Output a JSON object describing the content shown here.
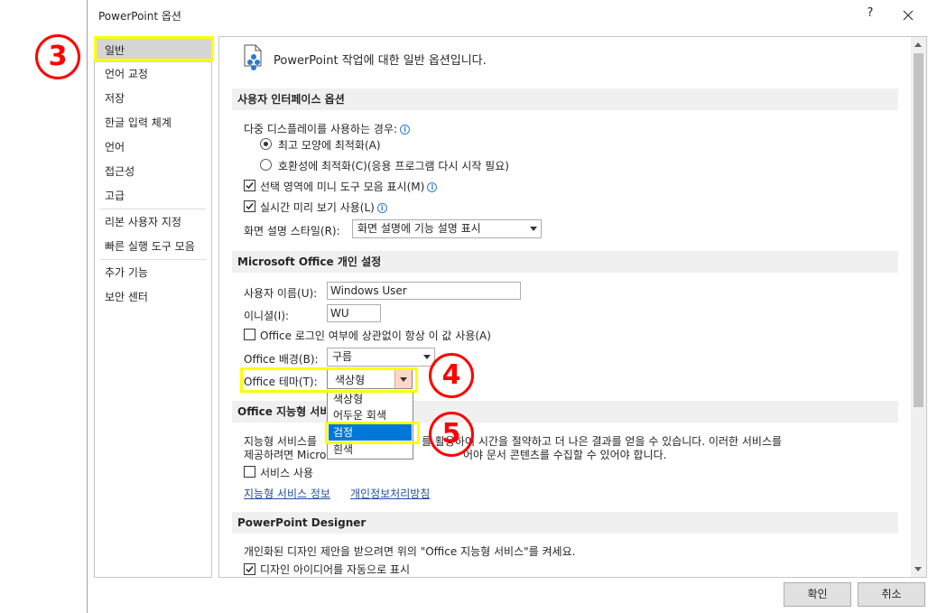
{
  "window": {
    "title": "PowerPoint 옵션",
    "help": "?"
  },
  "nav": {
    "items": [
      {
        "label": "일반"
      },
      {
        "label": "언어 교정"
      },
      {
        "label": "저장"
      },
      {
        "label": "한글 입력 체계"
      },
      {
        "label": "언어"
      },
      {
        "label": "접근성"
      },
      {
        "label": "고급"
      },
      {
        "label": "리본 사용자 지정"
      },
      {
        "label": "빠른 실행 도구 모음"
      },
      {
        "label": "추가 기능"
      },
      {
        "label": "보안 센터"
      }
    ],
    "selected": "일반"
  },
  "header": {
    "text": "PowerPoint 작업에 대한 일반 옵션입니다."
  },
  "ui_options": {
    "title": "사용자 인터페이스 옵션",
    "multi_display_label": "다중 디스플레이를 사용하는 경우:",
    "radio_optimize_appearance": "최고 모양에 최적화(A)",
    "radio_optimize_compat": "호환성에 최적화(C)(응용 프로그램 다시 시작 필요)",
    "mini_toolbar": "선택 영역에 미니 도구 모음 표시(M)",
    "live_preview": "실시간 미리 보기 사용(L)",
    "screentip_label": "화면 설명 스타일(R):",
    "screentip_value": "화면 설명에 기능 설명 표시"
  },
  "personalize": {
    "title": "Microsoft Office 개인 설정",
    "username_label": "사용자 이름(U):",
    "username_value": "Windows User",
    "initials_label": "이니셜(I):",
    "initials_value": "WU",
    "always_use_label": "Office 로그인 여부에 상관없이 항상 이 값 사용(A)",
    "background_label": "Office 배경(B):",
    "background_value": "구름",
    "theme_label": "Office 테마(T):",
    "theme_value": "색상형",
    "theme_options": [
      "색상형",
      "어두운 회색",
      "검정",
      "흰색"
    ],
    "theme_highlighted": "검정"
  },
  "intelligent": {
    "title": "Office 지능형 서비",
    "desc_line1_a": "지능형 서비스를",
    "desc_line1_b": "를 활용하여 시간을 절약하고 더 나은 결과를 얻을 수 있습니다. 이러한 서비스를",
    "desc_line2_a": "제공하려면 Micro",
    "desc_line2_b": "어야 문서 콘텐츠를 수집할 수 있어야 합니다.",
    "enable_label": "서비스 사용",
    "link_about": "지능형 서비스 정보",
    "link_privacy": "개인정보처리방침"
  },
  "designer": {
    "title": "PowerPoint Designer",
    "desc": "개인화된 디자인 제안을 받으려면 위의 \"Office 지능형 서비스\"를 켜세요.",
    "auto_show": "디자인 아이디어를 자동으로 표시"
  },
  "buttons": {
    "ok": "확인",
    "cancel": "취소"
  },
  "annotations": {
    "step3": "3",
    "step4": "4",
    "step5": "5"
  },
  "colors": {
    "highlight_yellow": "#ffff00",
    "annotation_red": "#ff0000",
    "selection_blue": "#0078d7"
  }
}
